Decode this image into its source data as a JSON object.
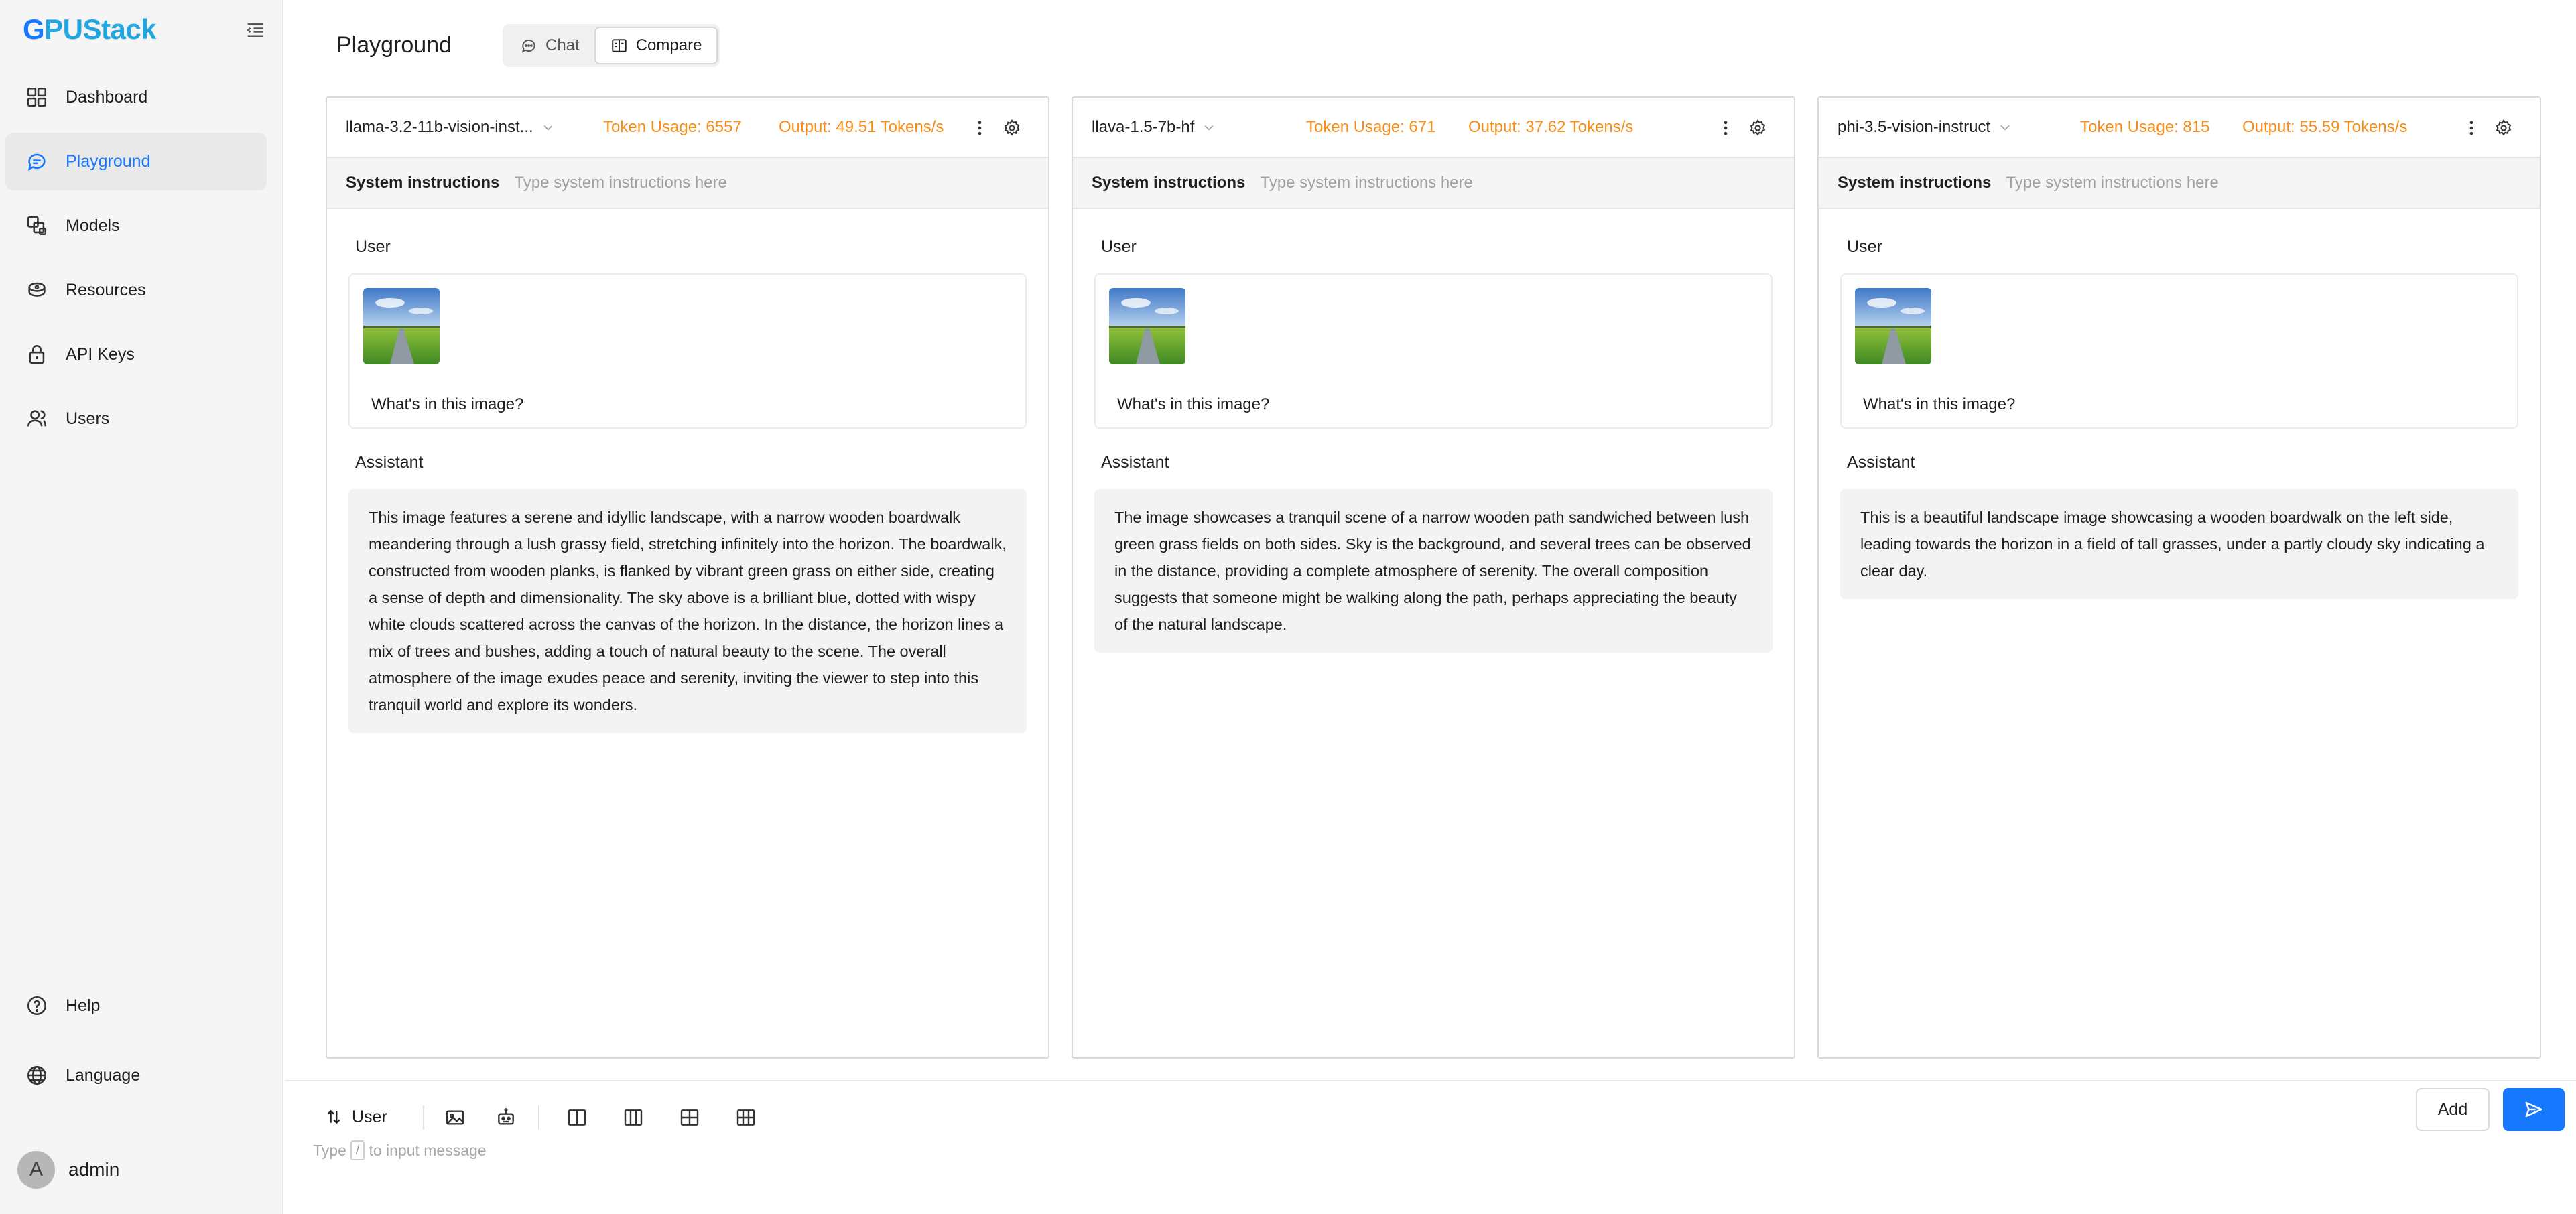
{
  "app": {
    "logo_first": "G",
    "logo_rest": "PUStack",
    "accent_color": "#1677ff",
    "warn_color": "#fa8c16"
  },
  "sidebar": {
    "items": [
      {
        "label": "Dashboard",
        "icon": "dashboard-icon"
      },
      {
        "label": "Playground",
        "icon": "chat-bubble-icon",
        "active": true
      },
      {
        "label": "Models",
        "icon": "models-icon"
      },
      {
        "label": "Resources",
        "icon": "resources-icon"
      },
      {
        "label": "API Keys",
        "icon": "lock-icon"
      },
      {
        "label": "Users",
        "icon": "users-icon"
      }
    ],
    "help_label": "Help",
    "language_label": "Language",
    "user": {
      "initial": "A",
      "name": "admin"
    }
  },
  "header": {
    "title": "Playground",
    "modes": [
      {
        "label": "Chat",
        "icon": "chat-icon",
        "active": false
      },
      {
        "label": "Compare",
        "icon": "compare-icon",
        "active": true
      }
    ]
  },
  "panels": [
    {
      "model": "llama-3.2-11b-vision-inst...",
      "token_usage": "Token Usage: 6557",
      "output": "Output: 49.51 Tokens/s",
      "system_label": "System instructions",
      "system_placeholder": "Type system instructions here",
      "user_role": "User",
      "user_text": "What's in this image?",
      "assistant_role": "Assistant",
      "assistant_text": "This image features a serene and idyllic landscape, with a narrow wooden boardwalk meandering through a lush grassy field, stretching infinitely into the horizon. The boardwalk, constructed from wooden planks, is flanked by vibrant green grass on either side, creating a sense of depth and dimensionality. The sky above is a brilliant blue, dotted with wispy white clouds scattered across the canvas of the horizon. In the distance, the horizon lines a mix of trees and bushes, adding a touch of natural beauty to the scene. The overall atmosphere of the image exudes peace and serenity, inviting the viewer to step into this tranquil world and explore its wonders."
    },
    {
      "model": "llava-1.5-7b-hf",
      "token_usage": "Token Usage: 671",
      "output": "Output: 37.62 Tokens/s",
      "system_label": "System instructions",
      "system_placeholder": "Type system instructions here",
      "user_role": "User",
      "user_text": "What's in this image?",
      "assistant_role": "Assistant",
      "assistant_text": "The image showcases a tranquil scene of a narrow wooden path sandwiched between lush green grass fields on both sides. Sky is the background, and several trees can be observed in the distance, providing a complete atmosphere of serenity. The overall composition suggests that someone might be walking along the path, perhaps appreciating the beauty of the natural landscape."
    },
    {
      "model": "phi-3.5-vision-instruct",
      "token_usage": "Token Usage: 815",
      "output": "Output: 55.59 Tokens/s",
      "system_label": "System instructions",
      "system_placeholder": "Type system instructions here",
      "user_role": "User",
      "user_text": "What's in this image?",
      "assistant_role": "Assistant",
      "assistant_text": " This is a beautiful landscape image showcasing a wooden boardwalk on the left side, leading towards the horizon in a field of tall grasses, under a partly cloudy sky indicating a clear day."
    }
  ],
  "composer": {
    "role_label": "User",
    "hint_before": "Type",
    "hint_key": "/",
    "hint_after": "to input message",
    "add_label": "Add",
    "tools": [
      "image-icon",
      "robot-icon",
      "layout-2col-icon",
      "layout-3col-icon",
      "layout-2x2-icon",
      "layout-3x2-icon"
    ],
    "send_icon": "send-icon"
  }
}
